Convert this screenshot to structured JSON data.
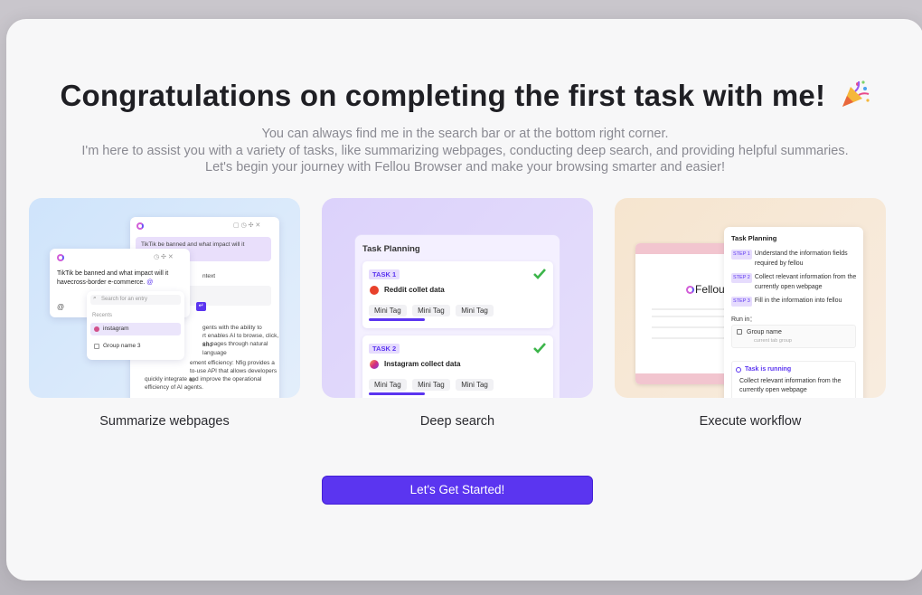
{
  "modal": {
    "title": "Congratulations on completing the first task with me!",
    "subtitle_lines": [
      "You can always find me in the search bar or at the bottom right corner.",
      "I'm here to assist you with a variety of tasks, like summarizing webpages, conducting deep search, and providing helpful summaries.",
      "Let's begin your journey with Fellou Browser and make your browsing smarter and easier!"
    ],
    "cta_label": "Let's Get Started!"
  },
  "cards": [
    {
      "label": "Summarize webpages",
      "preview": {
        "back_bubble": "TikTik be banned and what impact will it havecross-",
        "front_text": "TikTik be banned and what impact will it havecross-border e-commerce.",
        "at_symbol": "@",
        "search_placeholder": "Search for an entry",
        "recents": "Recents",
        "items": [
          "instagram",
          "Group name 3"
        ],
        "back_context": "ntext",
        "back_body_1": "gents with the ability to",
        "back_body_2": "rt enables AI to browse, click, and",
        "back_body_3": "eb pages through natural language",
        "back_body_4": "ement efficiency: Nfig provides a",
        "back_body_5": "to-use API that allows developers to",
        "back_body_6": "quickly integrate and improve the operational",
        "back_body_7": "efficiency of AI agents."
      }
    },
    {
      "label": "Deep search",
      "preview": {
        "panel_title": "Task Planning",
        "tasks": [
          {
            "badge": "TASK 1",
            "name": "Reddit collet data",
            "tags": [
              "Mini Tag",
              "Mini Tag",
              "Mini Tag"
            ]
          },
          {
            "badge": "TASK 2",
            "name": "Instagram collect data",
            "tags": [
              "Mini Tag",
              "Mini Tag",
              "Mini Tag"
            ]
          }
        ]
      }
    },
    {
      "label": "Execute workflow",
      "preview": {
        "logo_text": "Fellou",
        "panel_title": "Task Planning",
        "steps": [
          {
            "badge": "STEP 1",
            "text": "Understand the information fields required by fellou"
          },
          {
            "badge": "STEP 2",
            "text": "Collect relevant information from the currently open webpage"
          },
          {
            "badge": "STEP 3",
            "text": "Fill in the information into fellou"
          }
        ],
        "run_in": "Run in：",
        "group_name": "Group name",
        "group_sub": "current tab group",
        "running_title": "Task is running",
        "running_desc": "Collect relevant information from the currently open webpage"
      }
    }
  ],
  "colors": {
    "accent": "#5b35f0",
    "card1_bg": "#d6e8fb",
    "card2_bg": "#e0d7fb",
    "card3_bg": "#f7e8d6"
  },
  "icons": [
    "party-popper-icon",
    "check-icon",
    "reddit-icon",
    "instagram-icon",
    "fellou-logo-icon",
    "search-icon",
    "folder-icon"
  ]
}
